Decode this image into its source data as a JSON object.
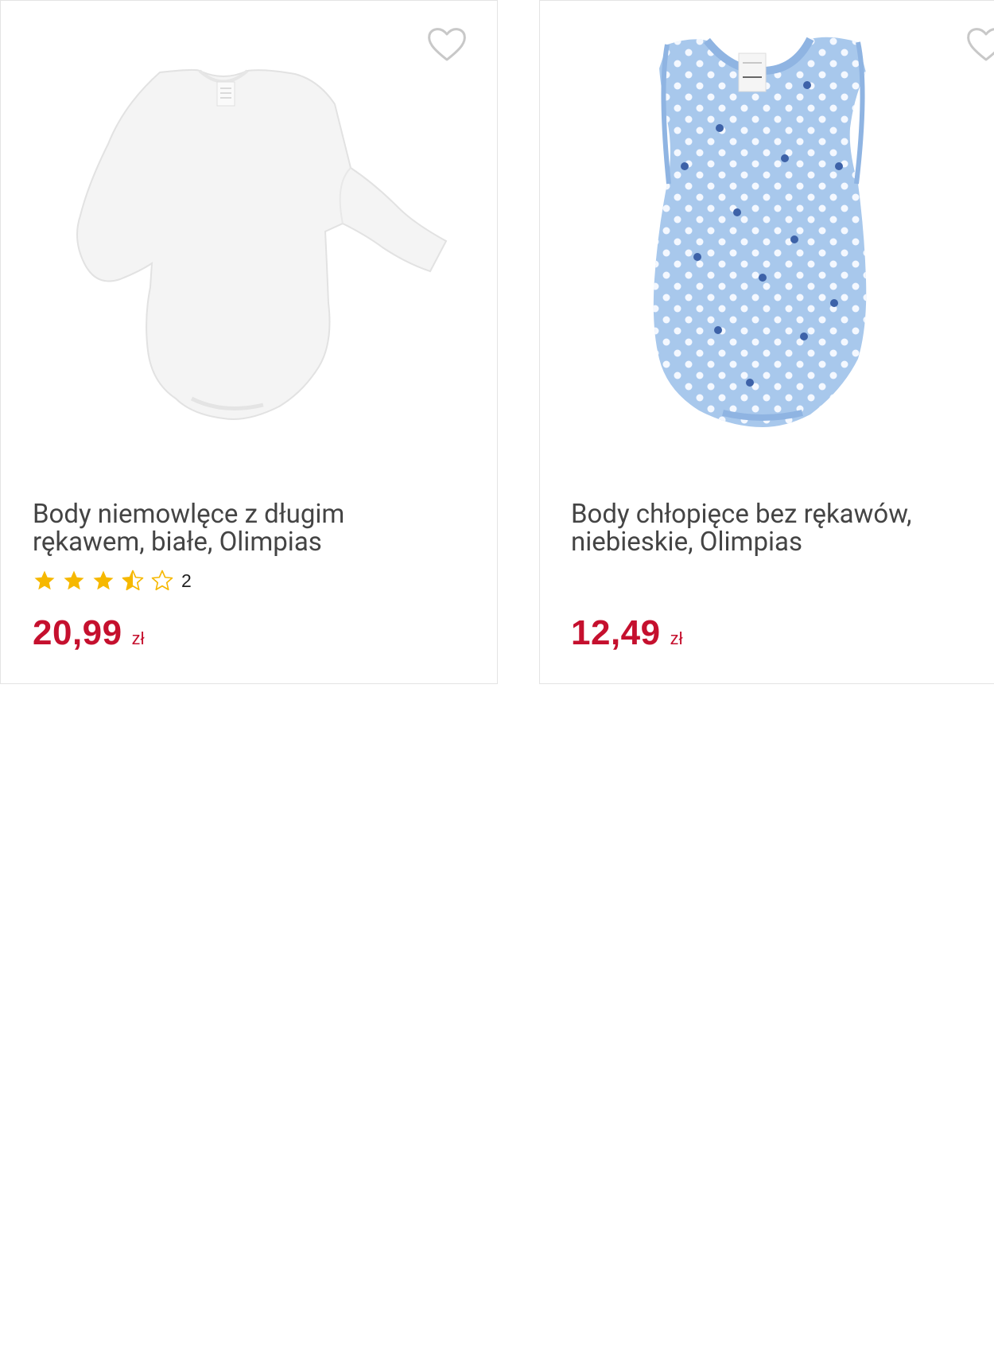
{
  "products": [
    {
      "title": "Body niemowlęce z długim rękawem, białe, Olimpias",
      "rating_count": "2",
      "rating_value": 3.5,
      "price": "20,99",
      "currency": "zł",
      "image_icon": "white-long-sleeve-bodysuit-image"
    },
    {
      "title": "Body chłopięce bez rękawów, niebieskie, Olimpias",
      "price": "12,49",
      "currency": "zł",
      "image_icon": "blue-sleeveless-star-bodysuit-image"
    }
  ],
  "colors": {
    "price": "#c5102e",
    "star": "#f6b800",
    "border": "#e4e4e4",
    "bodysuit_blue": "#a8c8ec"
  }
}
